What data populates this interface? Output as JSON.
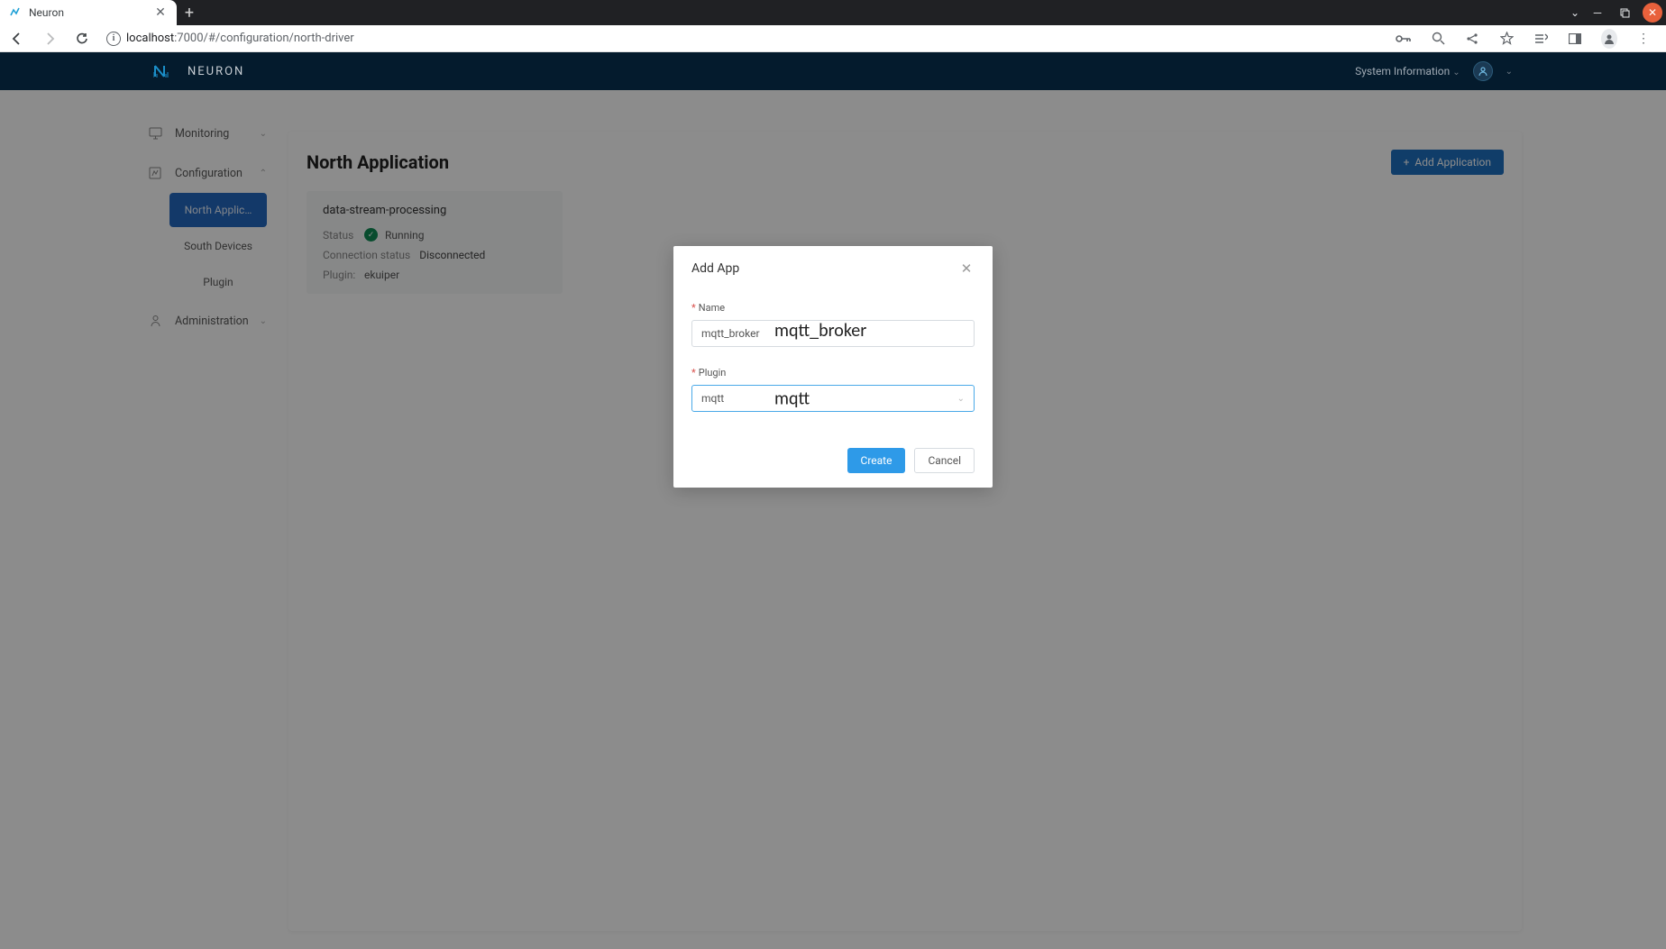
{
  "browser": {
    "tab_title": "Neuron",
    "url_host": "localhost",
    "url_path": ":7000/#/configuration/north-driver"
  },
  "header": {
    "brand": "NEURON",
    "system_info": "System Information"
  },
  "sidebar": {
    "monitoring": "Monitoring",
    "configuration": "Configuration",
    "administration": "Administration",
    "items": {
      "north": "North Applic…",
      "south": "South Devices",
      "plugin": "Plugin"
    }
  },
  "main": {
    "title": "North Application",
    "add_button": "Add Application",
    "card": {
      "title": "data-stream-processing",
      "status_label": "Status",
      "status_value": "Running",
      "conn_label": "Connection status",
      "conn_value": "Disconnected",
      "plugin_label": "Plugin:",
      "plugin_value": "ekuiper"
    }
  },
  "modal": {
    "title": "Add App",
    "name_label": "Name",
    "name_value": "mqtt_broker",
    "name_annotation": "mqtt_broker",
    "plugin_label": "Plugin",
    "plugin_value": "mqtt",
    "plugin_annotation": "mqtt",
    "create": "Create",
    "cancel": "Cancel"
  }
}
